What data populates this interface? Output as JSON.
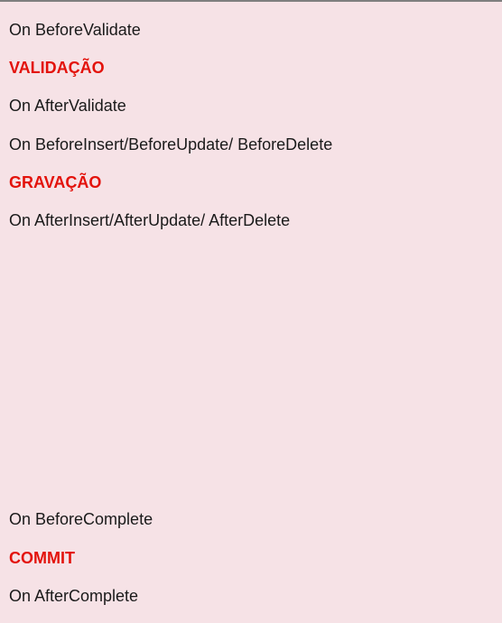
{
  "events": {
    "before_validate": "On BeforeValidate",
    "validation": "VALIDAÇÃO",
    "after_validate": "On AfterValidate",
    "before_write": "On BeforeInsert/BeforeUpdate/ BeforeDelete",
    "write": "GRAVAÇÃO",
    "after_write": "On AfterInsert/AfterUpdate/ AfterDelete",
    "before_complete": "On BeforeComplete",
    "commit": "COMMIT",
    "after_complete": "On AfterComplete"
  },
  "colors": {
    "background": "#f6e2e6",
    "stage_text": "#e3120b",
    "event_text": "#1a1a1a",
    "top_border": "#7f7f7f"
  }
}
